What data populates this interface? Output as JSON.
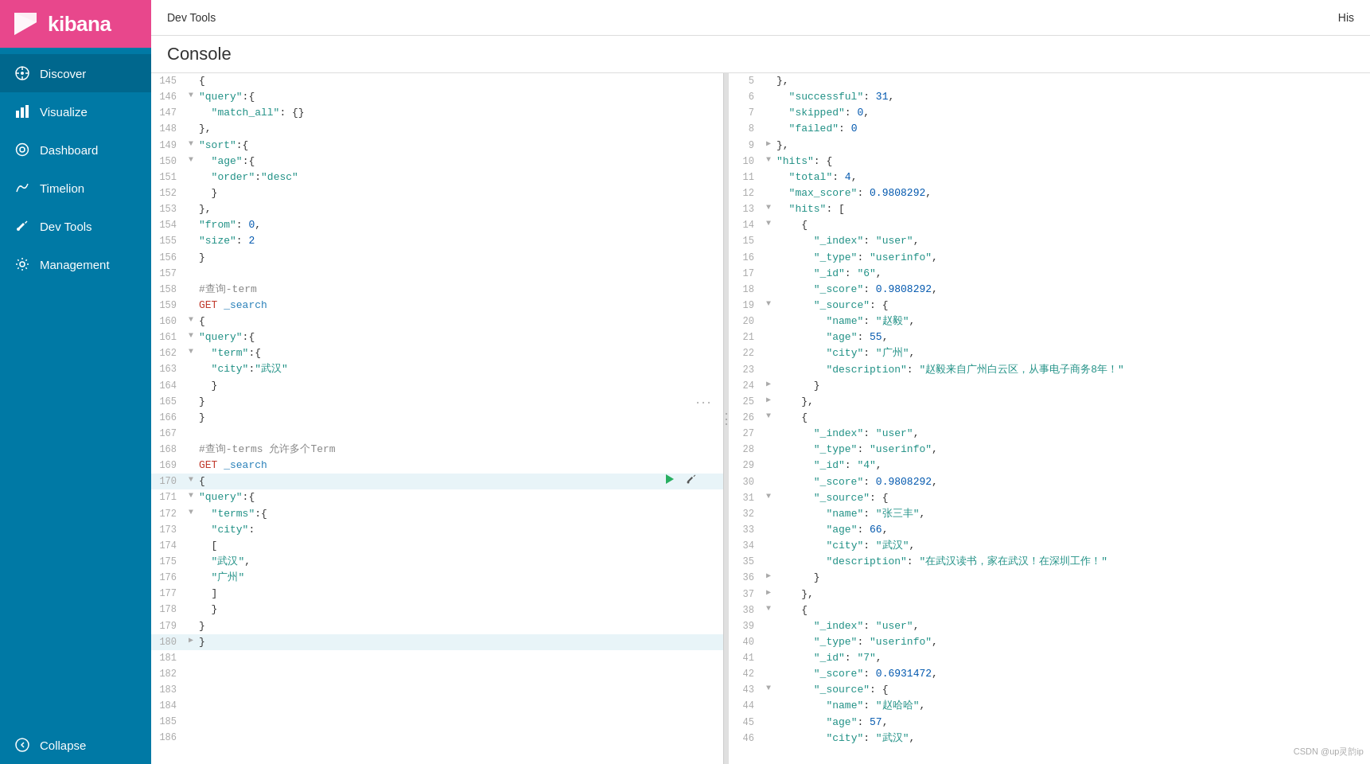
{
  "sidebar": {
    "logo_text": "kibana",
    "items": [
      {
        "label": "Discover",
        "icon": "compass"
      },
      {
        "label": "Visualize",
        "icon": "bar-chart"
      },
      {
        "label": "Dashboard",
        "icon": "circle-outline"
      },
      {
        "label": "Timelion",
        "icon": "lightning"
      },
      {
        "label": "Dev Tools",
        "icon": "wrench"
      },
      {
        "label": "Management",
        "icon": "gear"
      }
    ],
    "collapse_label": "Collapse"
  },
  "topbar": {
    "title": "Dev Tools",
    "history_label": "His"
  },
  "console_title": "Console",
  "watermark": "CSDN @up灵韵ip"
}
